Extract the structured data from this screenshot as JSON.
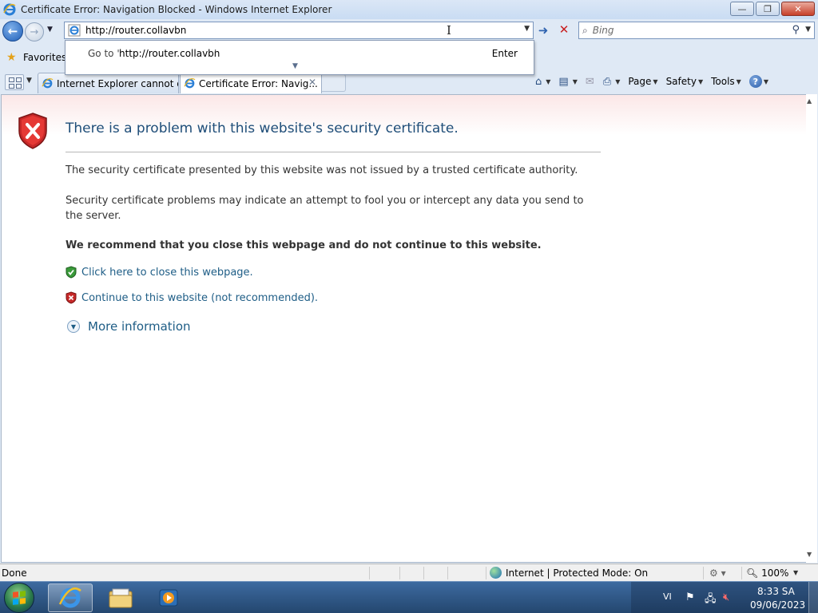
{
  "window": {
    "title": "Certificate Error: Navigation Blocked - Windows Internet Explorer",
    "controls": {
      "minimize": "—",
      "maximize": "❐",
      "close": "✕"
    }
  },
  "nav": {
    "address": "http://router.collavbn",
    "search_placeholder": "Bing",
    "go_icon": "arrow-right-icon",
    "stop_icon": "stop-x-icon"
  },
  "autocomplete": {
    "goto_prefix": "Go to '",
    "goto_url": "http://router.collavbn",
    "goto_suffix": "'",
    "enter_label": "Enter"
  },
  "favorites": {
    "label": "Favorites"
  },
  "tabs": [
    {
      "title": "Internet Explorer cannot di...",
      "active": false
    },
    {
      "title": "Certificate Error: Navig...",
      "active": true,
      "close": "✕"
    }
  ],
  "commandbar": {
    "page": "Page",
    "safety": "Safety",
    "tools": "Tools",
    "help": "?"
  },
  "content": {
    "title": "There is a problem with this website's security certificate.",
    "para1": "The security certificate presented by this website was not issued by a trusted certificate authority.",
    "para2": "Security certificate problems may indicate an attempt to fool you or intercept any data you send to the server.",
    "recommend": "We recommend that you close this webpage and do not continue to this website.",
    "close_link": "Click here to close this webpage.",
    "continue_link": "Continue to this website (not recommended).",
    "more_info": "More information"
  },
  "status": {
    "text": "Done",
    "zone": "Internet | Protected Mode: On",
    "zoom": "100%"
  },
  "taskbar": {
    "lang": "VI",
    "time": "8:33 SA",
    "date": "09/06/2023"
  },
  "colors": {
    "link": "#1e5d86",
    "title": "#1f4e79",
    "error_red": "#c81e1e",
    "taskbar": "#2c5283"
  }
}
